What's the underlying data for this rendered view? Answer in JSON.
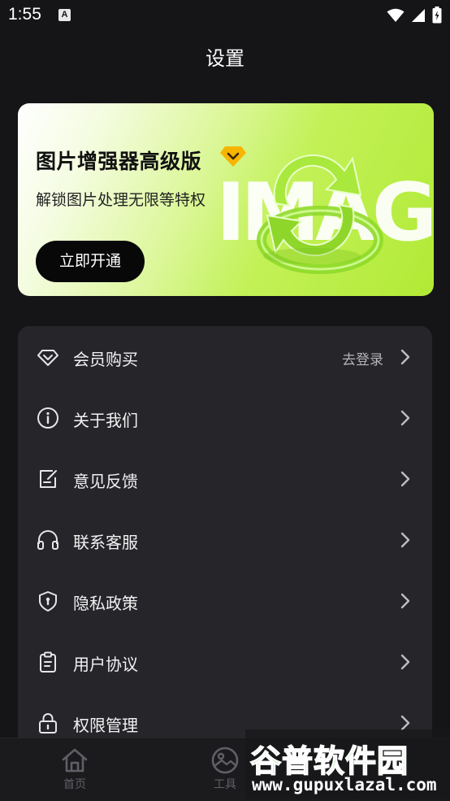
{
  "status_bar": {
    "time": "1:55",
    "notification_icon": "A",
    "icons": [
      "wifi-icon",
      "signal-icon",
      "battery-icon"
    ]
  },
  "header": {
    "title": "设置"
  },
  "banner": {
    "title": "图片增强器高级版",
    "subtitle": "解锁图片处理无限等特权",
    "button": "立即开通",
    "art_text": "IMAGE",
    "gem_icon": "vip-diamond-icon"
  },
  "menu": {
    "items": [
      {
        "label": "会员购买",
        "hint": "去登录",
        "icon": "diamond-icon"
      },
      {
        "label": "关于我们",
        "hint": "",
        "icon": "info-icon"
      },
      {
        "label": "意见反馈",
        "hint": "",
        "icon": "feedback-icon"
      },
      {
        "label": "联系客服",
        "hint": "",
        "icon": "headphones-icon"
      },
      {
        "label": "隐私政策",
        "hint": "",
        "icon": "shield-icon"
      },
      {
        "label": "用户协议",
        "hint": "",
        "icon": "clipboard-icon"
      },
      {
        "label": "权限管理",
        "hint": "",
        "icon": "lock-icon"
      }
    ]
  },
  "bottom_nav": {
    "items": [
      {
        "label": "首页",
        "icon": "home-icon"
      },
      {
        "label": "工具",
        "icon": "image-tool-icon"
      }
    ]
  },
  "watermark": {
    "brand": "谷普软件园",
    "url": "www.gupuxlazal.com"
  },
  "colors": {
    "background": "#151518",
    "card": "#25252a",
    "banner_accent": "#b2ea36",
    "vip_gold": "#f7b500"
  }
}
